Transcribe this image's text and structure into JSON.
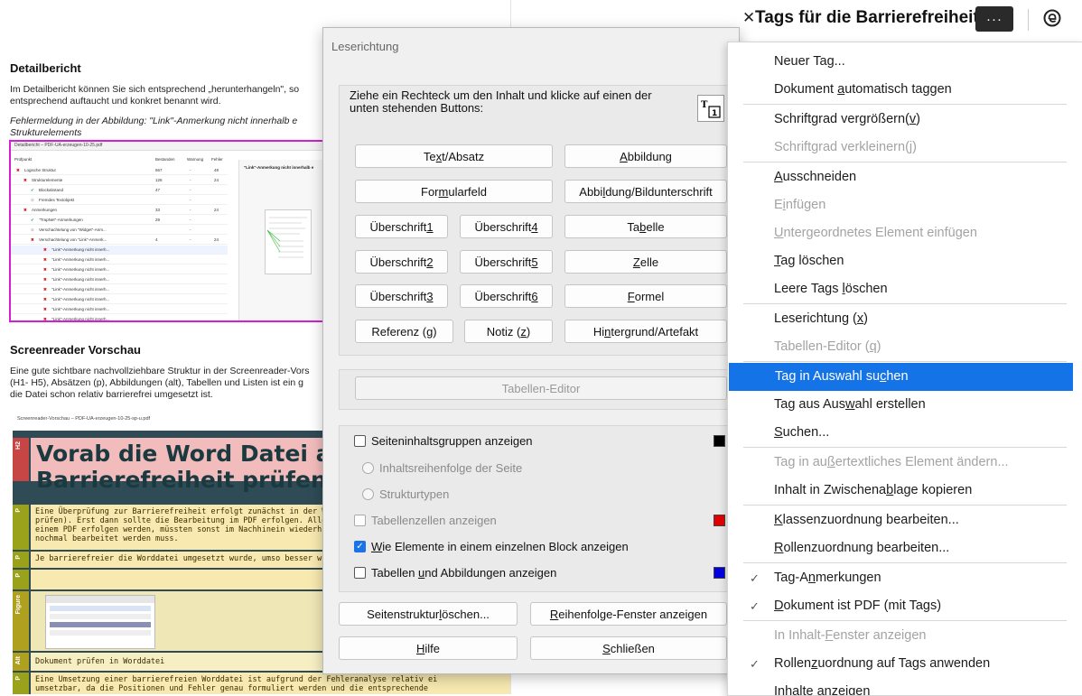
{
  "doc": {
    "detail_heading": "Detailbericht",
    "detail_p1": "Im Detailbericht können Sie sich entsprechend „herunterhangeln\", so",
    "detail_p2": "entsprechend auftaucht und konkret benannt wird.",
    "detail_italic1": "Fehlermeldung in der Abbildung: \"Link\"-Anmerkung nicht innerhalb e",
    "detail_italic2": "Strukturelements",
    "shot1": {
      "titlebar": "Detailbericht – PDF-UA-erzeugen-10-25.pdf",
      "col_headers": [
        "Prüfpunkt",
        "Bestanden",
        "Warnung",
        "Fehler"
      ],
      "panel_title": "\"Link\"-Anmerkung nicht innerhalb e",
      "rows": [
        {
          "label": "Logische Struktur",
          "status": "x"
        },
        {
          "label": "Strukturelemente",
          "status": "x"
        },
        {
          "label": "Blockabstand",
          "status": "ok"
        },
        {
          "label": "Fremdes Textobjekt",
          "status": "na"
        },
        {
          "label": "Anmerkungen",
          "status": "x"
        },
        {
          "label": "\"TrapNet\"-Anmerkungen",
          "status": "ok"
        },
        {
          "label": "Verschachtelung von \"Widget\"-Anm...",
          "status": "na"
        },
        {
          "label": "Verschachtelung von \"Link\"-Anmerk...",
          "status": "x"
        },
        {
          "label": "\"Link\"-Anmerkung nicht innerh...",
          "status": "x"
        },
        {
          "label": "\"Link\"-Anmerkung nicht innerh...",
          "status": "x"
        },
        {
          "label": "\"Link\"-Anmerkung nicht innerh...",
          "status": "x"
        },
        {
          "label": "\"Link\"-Anmerkung nicht innerh...",
          "status": "x"
        },
        {
          "label": "\"Link\"-Anmerkung nicht innerh...",
          "status": "x"
        },
        {
          "label": "\"Link\"-Anmerkung nicht innerh...",
          "status": "x"
        },
        {
          "label": "\"Link\"-Anmerkung nicht innerh...",
          "status": "x"
        },
        {
          "label": "\"Link\"-Anmerkung nicht innerh...",
          "status": "x"
        }
      ],
      "counts": [
        [
          "667",
          "-",
          "48"
        ],
        [
          "126",
          "-",
          "24"
        ],
        [
          "47",
          "-",
          ""
        ],
        [
          "",
          "-",
          ""
        ],
        [
          "33",
          "-",
          "24"
        ],
        [
          "29",
          "-",
          ""
        ],
        [
          "",
          "-",
          ""
        ],
        [
          "4",
          "-",
          "24"
        ]
      ]
    },
    "sr_heading": "Screenreader Vorschau",
    "sr_p1": "Eine gute sichtbare nachvollziehbare Struktur in der Screenreader-Vors",
    "sr_p2": "(H1- H5), Absätzen (p), Abbildungen (alt), Tabellen und Listen ist ein g",
    "sr_p3": "die Datei schon relativ barrierefrei umgesetzt ist.",
    "shot2_caption": "Screenreader-Vorschau – PDF-UA-erzeugen-10-25-sp-u.pdf",
    "shot2": {
      "h2_tag": "H2",
      "h2_line1": "Vorab die Word Datei au",
      "h2_line2": "Barrierefreiheit prüfen",
      "p_tag": "P",
      "p1_lines": [
        "Eine Überprüfung zur Barrierefreiheit erfolgt zunächst in der Wordd",
        "prüfen). Erst dann sollte die Bearbeitung im PDF erfolgen. Alle Arb",
        "einem PDF erfolgen werden, müssten sonst im Nachhinein wiederh",
        "nochmal bearbeitet werden muss."
      ],
      "p2": "Je barrierefreier die Worddatei umgesetzt wurde, umso besser wird",
      "figure_tag": "Figure",
      "alt_tag": "Alt",
      "alt_text": "Dokument prüfen in Worddatei",
      "p3_lines": [
        "Eine Umsetzung einer barrierefreien Worddatei ist aufgrund der Fehleranalyse relativ ei",
        "umsetzbar, da die Positionen und Fehler genau formuliert werden und die entsprechende"
      ]
    }
  },
  "dialog": {
    "title": "Leserichtung",
    "instruction": "Ziehe ein Rechteck um den Inhalt und klicke auf einen der unten stehenden Buttons:",
    "buttons": {
      "text_absatz": [
        "Te",
        "x",
        "t/Absatz"
      ],
      "abbildung": [
        "",
        "A",
        "bbildung"
      ],
      "formularfeld": [
        "For",
        "m",
        "ularfeld"
      ],
      "abbildung_unterschrift": [
        "Abbi",
        "l",
        "dung/Bildunterschrift"
      ],
      "h1": [
        "Überschrift ",
        "1",
        ""
      ],
      "h4": [
        "Überschrift ",
        "4",
        ""
      ],
      "tabelle": [
        "Ta",
        "b",
        "elle"
      ],
      "h2": [
        "Überschrift ",
        "2",
        ""
      ],
      "h5": [
        "Überschrift ",
        "5",
        ""
      ],
      "zelle": [
        "",
        "Z",
        "elle"
      ],
      "h3": [
        "Überschrift ",
        "3",
        ""
      ],
      "h6": [
        "Überschrift ",
        "6",
        ""
      ],
      "formel": [
        "",
        "F",
        "ormel"
      ],
      "referenz": [
        "Referenz (",
        "g",
        ")"
      ],
      "notiz": [
        "Notiz (",
        "z",
        ")"
      ],
      "hintergrund": [
        "Hi",
        "n",
        "tergrund/Artefakt"
      ]
    },
    "table_editor": "Tabellen-Editor",
    "options": {
      "seiteninhalt": "Seiteninhaltsgruppen anzeigen",
      "inhaltsreihenfolge": "Inhaltsreihenfolge der Seite",
      "strukturtypen": "Strukturtypen",
      "tabellenzellen": "Tabellenzellen anzeigen",
      "wie_elemente": [
        "",
        "W",
        "ie Elemente in einem einzelnen Block anzeigen"
      ],
      "tabellen_abbildungen": [
        "Tabellen ",
        "u",
        "nd Abbildungen anzeigen"
      ]
    },
    "swatch_colors": {
      "seiteninhalt": "#000000",
      "tabellenzellen": "#e30000",
      "tabellen_abbildungen": "#0000e0"
    },
    "footer": {
      "seitenstruktur": [
        "Seitenstruktur ",
        "l",
        "öschen..."
      ],
      "reihenfolge": [
        "",
        "R",
        "eihenfolge-Fenster anzeigen"
      ],
      "hilfe": [
        "",
        "H",
        "ilfe"
      ],
      "schliessen": [
        "",
        "S",
        "chließen"
      ]
    }
  },
  "panel": {
    "close_icon": "close-icon",
    "title": "Tags für die Barrierefreiheit",
    "more_label": "···",
    "help_icon": "help-icon"
  },
  "menu": {
    "items": [
      {
        "parts": [
          "Neuer Ta",
          "g",
          "..."
        ],
        "state": "normal"
      },
      {
        "parts": [
          "Dokument ",
          "a",
          "utomatisch taggen"
        ],
        "state": "normal"
      },
      {
        "sep": true
      },
      {
        "parts": [
          "Schriftgrad vergrößern(",
          "v",
          ")"
        ],
        "state": "normal"
      },
      {
        "parts": [
          "Schriftgrad verkleinern(",
          "j",
          ")"
        ],
        "state": "disabled"
      },
      {
        "sep": true
      },
      {
        "parts": [
          "",
          "A",
          "usschneiden"
        ],
        "state": "normal"
      },
      {
        "parts": [
          "E",
          "i",
          "nfügen"
        ],
        "state": "disabled"
      },
      {
        "parts": [
          "",
          "U",
          "ntergeordnetes Element einfügen"
        ],
        "state": "disabled"
      },
      {
        "parts": [
          "",
          "T",
          "ag löschen"
        ],
        "state": "normal"
      },
      {
        "parts": [
          "Leere Tags ",
          "l",
          "öschen"
        ],
        "state": "normal"
      },
      {
        "sep": true
      },
      {
        "parts": [
          "Leserichtung (",
          "x",
          ")"
        ],
        "state": "normal"
      },
      {
        "parts": [
          "Tabellen-Editor (",
          "q",
          ")"
        ],
        "state": "disabled"
      },
      {
        "sep": true
      },
      {
        "parts": [
          "Tag in Auswahl su",
          "c",
          "hen"
        ],
        "state": "active"
      },
      {
        "parts": [
          "Tag aus Aus",
          "w",
          "ahl erstellen"
        ],
        "state": "normal"
      },
      {
        "parts": [
          "",
          "S",
          "uchen..."
        ],
        "state": "normal"
      },
      {
        "sep": true
      },
      {
        "parts": [
          "Tag in au",
          "ß",
          "ertextliches Element ändern..."
        ],
        "state": "disabled"
      },
      {
        "parts": [
          "Inhalt in Zwischena",
          "b",
          "lage kopieren"
        ],
        "state": "normal"
      },
      {
        "sep": true
      },
      {
        "parts": [
          "",
          "K",
          "lassenzuordnung bearbeiten..."
        ],
        "state": "normal"
      },
      {
        "parts": [
          "",
          "R",
          "ollenzuordnung bearbeiten..."
        ],
        "state": "normal"
      },
      {
        "sep": true
      },
      {
        "parts": [
          "Tag-A",
          "n",
          "merkungen"
        ],
        "state": "normal",
        "checked": true
      },
      {
        "parts": [
          "",
          "D",
          "okument ist PDF (mit Tags)"
        ],
        "state": "normal",
        "checked": true
      },
      {
        "sep": true
      },
      {
        "parts": [
          "In Inhalt-",
          "F",
          "enster anzeigen"
        ],
        "state": "disabled"
      },
      {
        "parts": [
          "Rollen",
          "z",
          "uordnung auf Tags anwenden"
        ],
        "state": "normal",
        "checked": true
      },
      {
        "parts": [
          "I",
          "n",
          "halte anzeigen"
        ],
        "state": "normal"
      }
    ],
    "check_mark": "✓"
  }
}
